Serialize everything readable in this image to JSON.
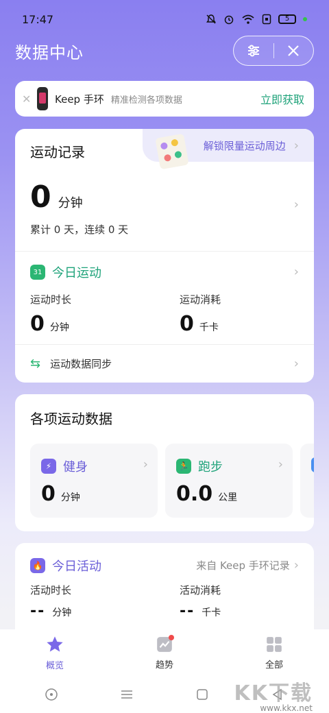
{
  "status_bar": {
    "time": "17:47",
    "battery": "5",
    "icons": [
      "mute-icon",
      "alarm-icon",
      "wifi-icon",
      "sim-icon",
      "battery-icon"
    ]
  },
  "header": {
    "title": "数据中心",
    "actions": [
      "settings-sliders-icon",
      "close-icon"
    ]
  },
  "promo": {
    "brand": "Keep 手环",
    "desc": "精准检测各项数据",
    "cta": "立即获取"
  },
  "record": {
    "title": "运动记录",
    "unlock_label": "解锁限量运动周边",
    "total_minutes": "0",
    "total_unit": "分钟",
    "summary": "累计 0 天，连续 0 天",
    "today_label": "今日运动",
    "calendar_day": "31",
    "duration_label": "运动时长",
    "duration_value": "0",
    "duration_unit": "分钟",
    "burn_label": "运动消耗",
    "burn_value": "0",
    "burn_unit": "千卡",
    "sync_label": "运动数据同步"
  },
  "various": {
    "title": "各项运动数据",
    "tiles": [
      {
        "name": "健身",
        "value": "0",
        "unit": "分钟",
        "color": "#7a68e8"
      },
      {
        "name": "跑步",
        "value": "0.0",
        "unit": "公里",
        "color": "#2bb673"
      }
    ]
  },
  "activity": {
    "title": "今日活动",
    "source": "来自 Keep 手环记录",
    "duration_label": "活动时长",
    "duration_value": "--",
    "duration_unit": "分钟",
    "burn_label": "活动消耗",
    "burn_value": "--",
    "burn_unit": "千卡"
  },
  "tabs": [
    {
      "label": "概览",
      "active": true
    },
    {
      "label": "趋势",
      "active": false
    },
    {
      "label": "全部",
      "active": false
    }
  ],
  "watermark": {
    "big": "KK下载",
    "small": "www.kkx.net"
  },
  "colors": {
    "accent": "#6b5fd8",
    "green": "#1fa37a",
    "badge": "#f04b4b"
  }
}
